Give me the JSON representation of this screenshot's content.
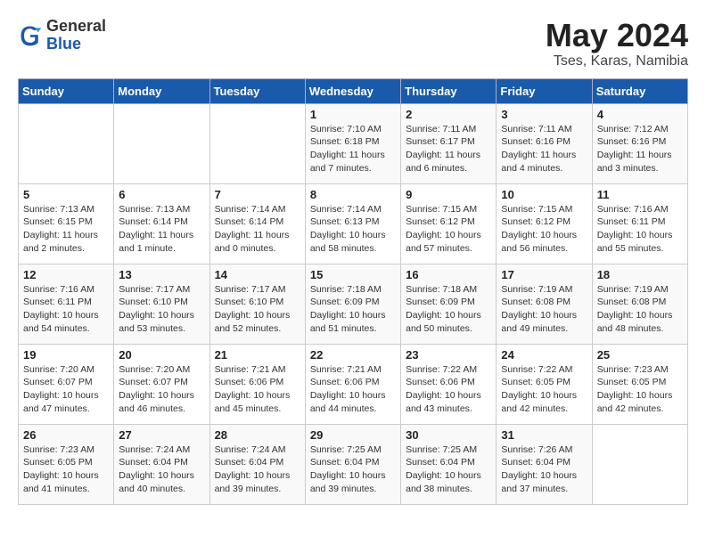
{
  "header": {
    "logo_general": "General",
    "logo_blue": "Blue",
    "month_year": "May 2024",
    "location": "Tses, Karas, Namibia"
  },
  "weekdays": [
    "Sunday",
    "Monday",
    "Tuesday",
    "Wednesday",
    "Thursday",
    "Friday",
    "Saturday"
  ],
  "weeks": [
    [
      {
        "day": "",
        "info": ""
      },
      {
        "day": "",
        "info": ""
      },
      {
        "day": "",
        "info": ""
      },
      {
        "day": "1",
        "info": "Sunrise: 7:10 AM\nSunset: 6:18 PM\nDaylight: 11 hours\nand 7 minutes."
      },
      {
        "day": "2",
        "info": "Sunrise: 7:11 AM\nSunset: 6:17 PM\nDaylight: 11 hours\nand 6 minutes."
      },
      {
        "day": "3",
        "info": "Sunrise: 7:11 AM\nSunset: 6:16 PM\nDaylight: 11 hours\nand 4 minutes."
      },
      {
        "day": "4",
        "info": "Sunrise: 7:12 AM\nSunset: 6:16 PM\nDaylight: 11 hours\nand 3 minutes."
      }
    ],
    [
      {
        "day": "5",
        "info": "Sunrise: 7:13 AM\nSunset: 6:15 PM\nDaylight: 11 hours\nand 2 minutes."
      },
      {
        "day": "6",
        "info": "Sunrise: 7:13 AM\nSunset: 6:14 PM\nDaylight: 11 hours\nand 1 minute."
      },
      {
        "day": "7",
        "info": "Sunrise: 7:14 AM\nSunset: 6:14 PM\nDaylight: 11 hours\nand 0 minutes."
      },
      {
        "day": "8",
        "info": "Sunrise: 7:14 AM\nSunset: 6:13 PM\nDaylight: 10 hours\nand 58 minutes."
      },
      {
        "day": "9",
        "info": "Sunrise: 7:15 AM\nSunset: 6:12 PM\nDaylight: 10 hours\nand 57 minutes."
      },
      {
        "day": "10",
        "info": "Sunrise: 7:15 AM\nSunset: 6:12 PM\nDaylight: 10 hours\nand 56 minutes."
      },
      {
        "day": "11",
        "info": "Sunrise: 7:16 AM\nSunset: 6:11 PM\nDaylight: 10 hours\nand 55 minutes."
      }
    ],
    [
      {
        "day": "12",
        "info": "Sunrise: 7:16 AM\nSunset: 6:11 PM\nDaylight: 10 hours\nand 54 minutes."
      },
      {
        "day": "13",
        "info": "Sunrise: 7:17 AM\nSunset: 6:10 PM\nDaylight: 10 hours\nand 53 minutes."
      },
      {
        "day": "14",
        "info": "Sunrise: 7:17 AM\nSunset: 6:10 PM\nDaylight: 10 hours\nand 52 minutes."
      },
      {
        "day": "15",
        "info": "Sunrise: 7:18 AM\nSunset: 6:09 PM\nDaylight: 10 hours\nand 51 minutes."
      },
      {
        "day": "16",
        "info": "Sunrise: 7:18 AM\nSunset: 6:09 PM\nDaylight: 10 hours\nand 50 minutes."
      },
      {
        "day": "17",
        "info": "Sunrise: 7:19 AM\nSunset: 6:08 PM\nDaylight: 10 hours\nand 49 minutes."
      },
      {
        "day": "18",
        "info": "Sunrise: 7:19 AM\nSunset: 6:08 PM\nDaylight: 10 hours\nand 48 minutes."
      }
    ],
    [
      {
        "day": "19",
        "info": "Sunrise: 7:20 AM\nSunset: 6:07 PM\nDaylight: 10 hours\nand 47 minutes."
      },
      {
        "day": "20",
        "info": "Sunrise: 7:20 AM\nSunset: 6:07 PM\nDaylight: 10 hours\nand 46 minutes."
      },
      {
        "day": "21",
        "info": "Sunrise: 7:21 AM\nSunset: 6:06 PM\nDaylight: 10 hours\nand 45 minutes."
      },
      {
        "day": "22",
        "info": "Sunrise: 7:21 AM\nSunset: 6:06 PM\nDaylight: 10 hours\nand 44 minutes."
      },
      {
        "day": "23",
        "info": "Sunrise: 7:22 AM\nSunset: 6:06 PM\nDaylight: 10 hours\nand 43 minutes."
      },
      {
        "day": "24",
        "info": "Sunrise: 7:22 AM\nSunset: 6:05 PM\nDaylight: 10 hours\nand 42 minutes."
      },
      {
        "day": "25",
        "info": "Sunrise: 7:23 AM\nSunset: 6:05 PM\nDaylight: 10 hours\nand 42 minutes."
      }
    ],
    [
      {
        "day": "26",
        "info": "Sunrise: 7:23 AM\nSunset: 6:05 PM\nDaylight: 10 hours\nand 41 minutes."
      },
      {
        "day": "27",
        "info": "Sunrise: 7:24 AM\nSunset: 6:04 PM\nDaylight: 10 hours\nand 40 minutes."
      },
      {
        "day": "28",
        "info": "Sunrise: 7:24 AM\nSunset: 6:04 PM\nDaylight: 10 hours\nand 39 minutes."
      },
      {
        "day": "29",
        "info": "Sunrise: 7:25 AM\nSunset: 6:04 PM\nDaylight: 10 hours\nand 39 minutes."
      },
      {
        "day": "30",
        "info": "Sunrise: 7:25 AM\nSunset: 6:04 PM\nDaylight: 10 hours\nand 38 minutes."
      },
      {
        "day": "31",
        "info": "Sunrise: 7:26 AM\nSunset: 6:04 PM\nDaylight: 10 hours\nand 37 minutes."
      },
      {
        "day": "",
        "info": ""
      }
    ]
  ]
}
